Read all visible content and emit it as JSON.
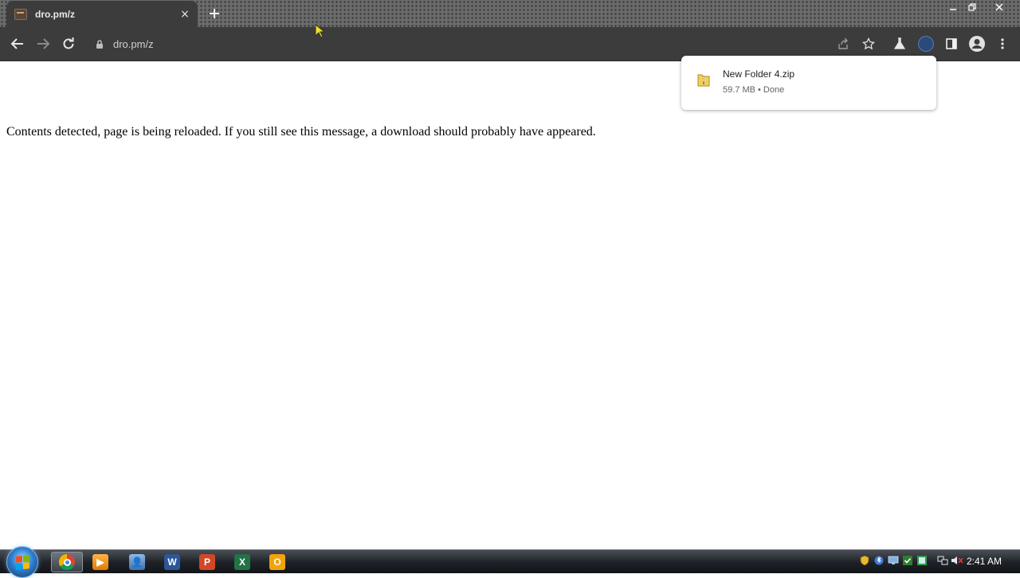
{
  "browser": {
    "tab": {
      "title": "dro.pm/z",
      "close_label": "×"
    },
    "address_bar": {
      "url": "dro.pm/z"
    }
  },
  "page": {
    "message": "Contents detected, page is being reloaded. If you still see this message, a download should probably have appeared."
  },
  "download": {
    "filename": "New Folder 4.zip",
    "status": "59.7 MB • Done"
  },
  "taskbar": {
    "apps": [
      "chrome",
      "media-player",
      "user-accounts",
      "word",
      "powerpoint",
      "excel",
      "outlook"
    ],
    "clock": "2:41 AM"
  },
  "colors": {
    "tab_bg": "#3c3c3c",
    "toolbar_bg": "#3c3c3c",
    "taskbar_bg": "#1d2126"
  }
}
